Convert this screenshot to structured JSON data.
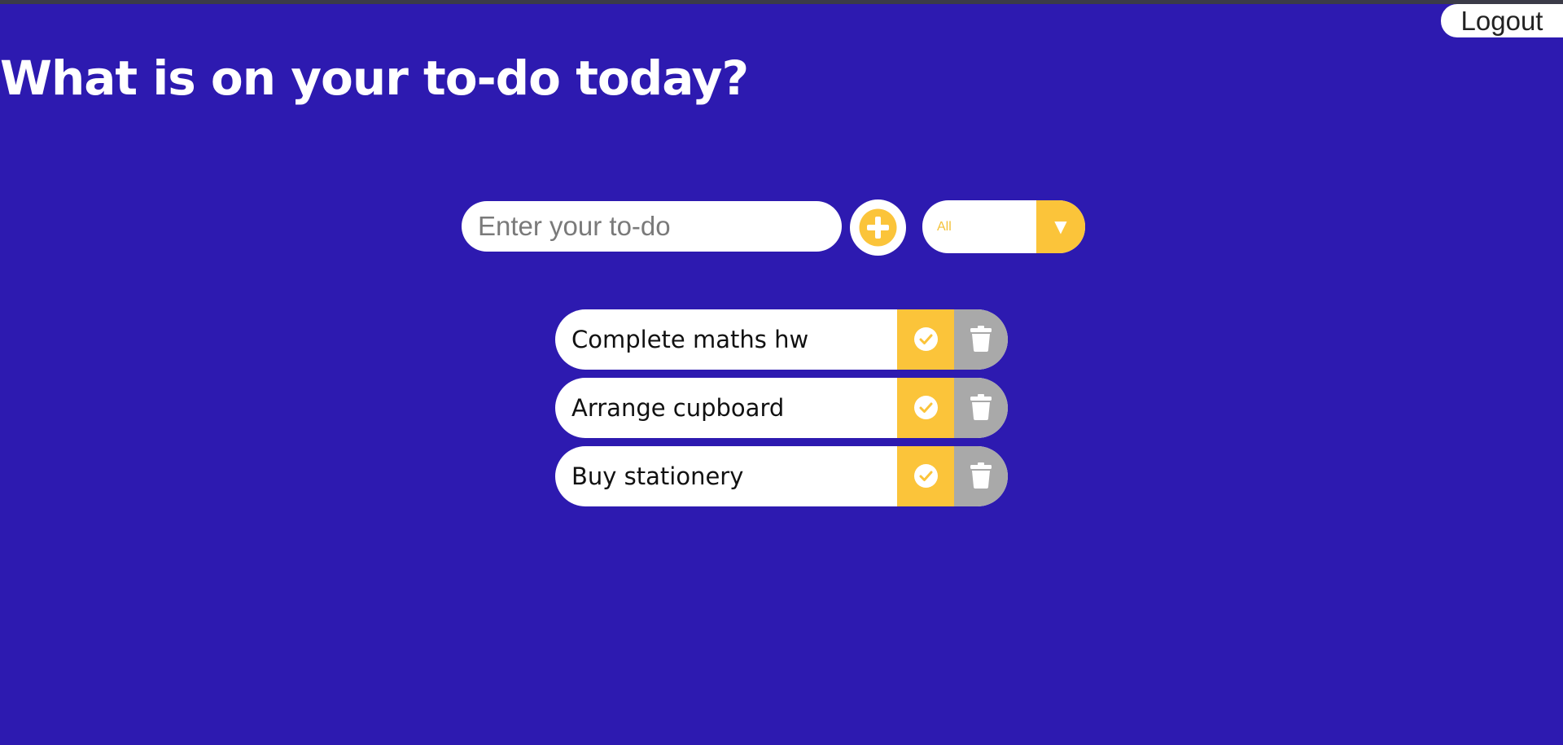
{
  "header": {
    "logout_label": "Logout",
    "title": "What is on your to-do today?"
  },
  "form": {
    "input_placeholder": "Enter your to-do",
    "input_value": "",
    "add_icon": "plus-circle-icon",
    "filter_selected": "All",
    "filter_arrow": "▼"
  },
  "todos": [
    {
      "text": "Complete maths hw"
    },
    {
      "text": "Arrange cupboard"
    },
    {
      "text": "Buy stationery"
    }
  ],
  "colors": {
    "background": "#2d1ab0",
    "accent_yellow": "#fbc43a",
    "trash_gray": "#a9a9a9"
  },
  "icons": {
    "complete": "check-circle-icon",
    "delete": "trash-icon"
  }
}
